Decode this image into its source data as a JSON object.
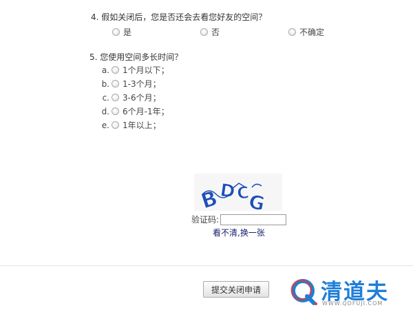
{
  "q4": {
    "title": "4. 假如关闭后，您是否还会去看您好友的空间？",
    "options": [
      "是",
      "否",
      "不确定"
    ]
  },
  "q5": {
    "title": "5. 您使用空间多长时间？",
    "options": [
      {
        "letter": "a.",
        "label": "1个月以下；"
      },
      {
        "letter": "b.",
        "label": "1-3个月；"
      },
      {
        "letter": "c.",
        "label": "3-6个月；"
      },
      {
        "letter": "d.",
        "label": "6个月-1年；"
      },
      {
        "letter": "e.",
        "label": "1年以上；"
      }
    ]
  },
  "captcha": {
    "label": "验证码:",
    "input_value": "",
    "refresh_link": "看不清,换一张",
    "image_letters": "BDCG"
  },
  "submit_button": "提交关闭申请",
  "watermark": {
    "brand": "清道夫",
    "url": "WWW.QDFUJI.COM"
  },
  "colors": {
    "link": "#17206b",
    "captcha_letters": "#1f4fb8",
    "watermark_blue": "#1e7fd8",
    "watermark_red": "#e03a3a"
  }
}
